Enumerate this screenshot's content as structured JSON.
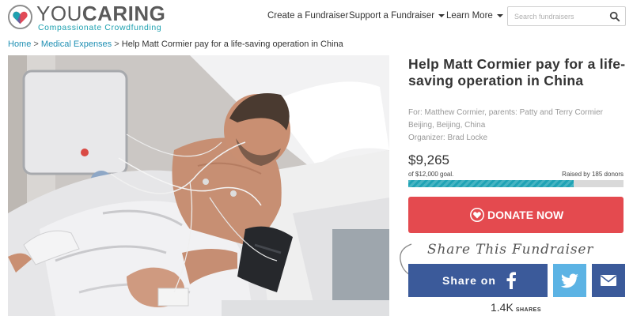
{
  "brand": {
    "name_part1": "YOU",
    "name_part2": "CARING",
    "tagline": "Compassionate Crowdfunding",
    "colors": {
      "teal": "#1ea1b0",
      "red": "#e44a4f",
      "facebook": "#3b5a9a",
      "twitter": "#5cb3e4"
    }
  },
  "nav": {
    "items": [
      {
        "label": "Create a Fundraiser",
        "has_dropdown": false
      },
      {
        "label": "Support a Fundraiser",
        "has_dropdown": true
      },
      {
        "label": "Learn More",
        "has_dropdown": true
      }
    ]
  },
  "search": {
    "placeholder": "Search fundraisers",
    "icon": "search-icon"
  },
  "breadcrumb": {
    "home": "Home",
    "category": "Medical Expenses",
    "separator": ">",
    "current": "Help Matt Cormier pay for a life-saving operation in China"
  },
  "fundraiser": {
    "title": "Help Matt Cormier pay for a life-saving operation in China",
    "for_line": "For: Matthew Cormier, parents: Patty and Terry Cormier",
    "location": "Beijing, Beijing, China",
    "organizer": "Organizer: Brad Locke",
    "raised_amount": "$9,265",
    "goal_text": "of $12,000 goal.",
    "donors_text": "Raised by 185 donors",
    "progress_fraction": 0.77
  },
  "donate": {
    "label": "DONATE NOW",
    "icon": "heart-hands-icon"
  },
  "share": {
    "title": "Share This Fundraiser",
    "facebook_label": "Share on",
    "facebook_icon": "facebook-icon",
    "twitter_icon": "twitter-icon",
    "email_icon": "mail-icon",
    "count": "1.4K",
    "count_label": "SHARES"
  }
}
